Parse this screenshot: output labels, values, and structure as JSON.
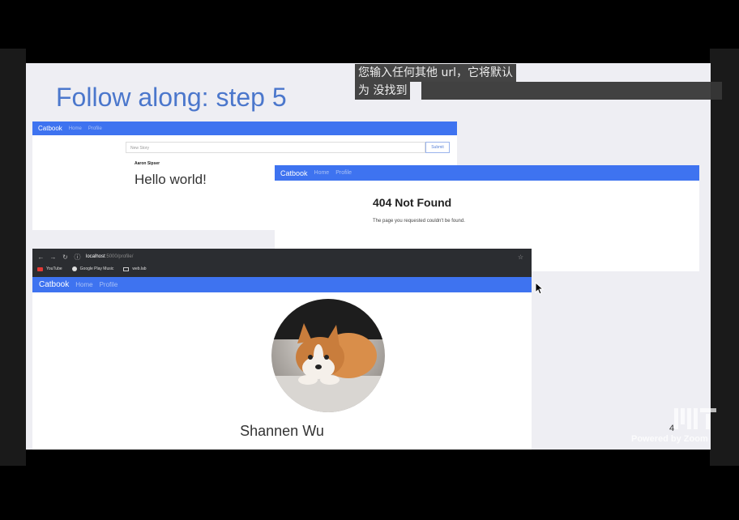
{
  "slide": {
    "title": "Follow along: step 5",
    "page_number": "4"
  },
  "window1": {
    "brand": "Catbook",
    "nav_home": "Home",
    "nav_profile": "Profile",
    "story_placeholder": "New Story",
    "submit_label": "Submit",
    "author": "Aaron Sipser",
    "story_text": "Hello world!"
  },
  "window2": {
    "brand": "Catbook",
    "nav_home": "Home",
    "nav_profile": "Profile",
    "heading": "404 Not Found",
    "message": "The page you requested couldn't be found."
  },
  "window3": {
    "url_host": "localhost",
    "url_path": ":5000/profile/",
    "bookmarks": [
      "YouTube",
      "Google Play Music",
      "web.lab"
    ],
    "brand": "Catbook",
    "nav_home": "Home",
    "nav_profile": "Profile",
    "profile_name": "Shannen Wu"
  },
  "caption": {
    "line1": "您输入任何其他 url，它将默认",
    "line2": "为 没找到"
  },
  "watermark": {
    "zoom": "Powered by Zoom"
  },
  "colors": {
    "navbar": "#3e73f0",
    "title": "#4b77cc"
  }
}
